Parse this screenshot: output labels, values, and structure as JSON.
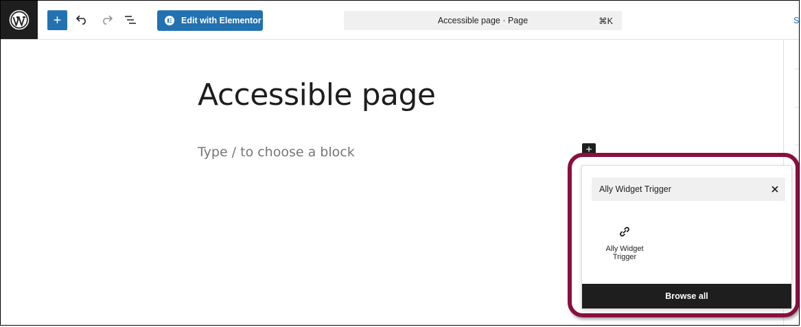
{
  "toolbar": {
    "add_block_glyph": "+",
    "elementor_label": "Edit with Elementor",
    "icons": [
      "wordpress-logo",
      "plus-icon",
      "undo-icon",
      "redo-icon",
      "list-view-icon"
    ]
  },
  "command_bar": {
    "title": "Accessible page · Page",
    "shortcut": "⌘K"
  },
  "header_right": {
    "save_label_visible": "Sa"
  },
  "editor": {
    "page_title": "Accessible page",
    "block_placeholder": "Type / to choose a block",
    "inserter_glyph": "+"
  },
  "quick_inserter": {
    "search_value": "Ally Widget Trigger",
    "results": [
      {
        "label": "Ally Widget Trigger",
        "icon": "link-icon"
      }
    ],
    "browse_all_label": "Browse all"
  },
  "colors": {
    "accent": "#2271b1",
    "dark": "#1e1e1e",
    "highlight": "#8a0f40"
  }
}
